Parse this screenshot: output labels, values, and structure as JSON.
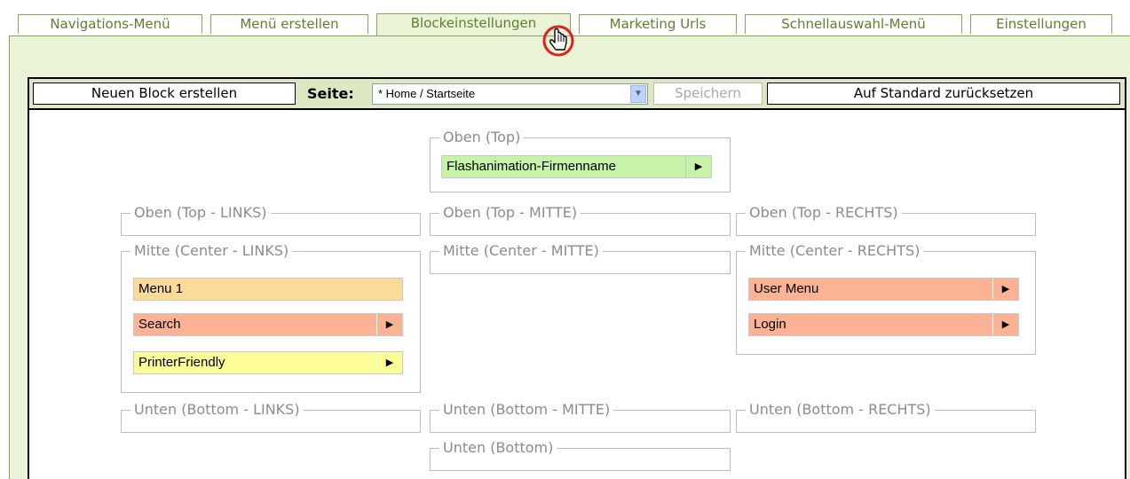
{
  "tabs": [
    {
      "label": "Navigations-Menü"
    },
    {
      "label": "Menü erstellen"
    },
    {
      "label": "Blockeinstellungen",
      "active": true
    },
    {
      "label": "Marketing Urls"
    },
    {
      "label": "Schnellauswahl-Menü"
    },
    {
      "label": "Einstellungen"
    }
  ],
  "toolbar": {
    "new_block": "Neuen Block erstellen",
    "seite_label": "Seite:",
    "seite_value": "* Home / Startseite",
    "save": "Speichern",
    "reset": "Auf Standard zurücksetzen"
  },
  "regions": {
    "top": {
      "label": "Oben (Top)",
      "blocks": [
        {
          "label": "Flashanimation-Firmenname",
          "color": "#c6f3a8",
          "has_arrow": true
        }
      ]
    },
    "top_left": {
      "label": "Oben (Top - LINKS)"
    },
    "top_center": {
      "label": "Oben (Top - MITTE)"
    },
    "top_right": {
      "label": "Oben (Top - RECHTS)"
    },
    "center_left": {
      "label": "Mitte (Center - LINKS)",
      "blocks": [
        {
          "label": "Menu 1",
          "color": "#fcdb98",
          "has_arrow": false
        },
        {
          "label": "Search",
          "color": "#fbb295",
          "has_arrow": true
        },
        {
          "label": "PrinterFriendly",
          "color": "#fdfd98",
          "has_arrow": true
        }
      ]
    },
    "center_center": {
      "label": "Mitte (Center - MITTE)"
    },
    "center_right": {
      "label": "Mitte (Center - RECHTS)",
      "blocks": [
        {
          "label": "User Menu",
          "color": "#fbb295",
          "has_arrow": true
        },
        {
          "label": "Login",
          "color": "#fbb295",
          "has_arrow": true
        }
      ]
    },
    "bottom_left": {
      "label": "Unten (Bottom - LINKS)"
    },
    "bottom_center": {
      "label": "Unten (Bottom - MITTE)"
    },
    "bottom_right": {
      "label": "Unten (Bottom - RECHTS)"
    },
    "bottom": {
      "label": "Unten (Bottom)"
    }
  },
  "icons": {
    "arrow": "triangle-right-icon",
    "select_arrow": "chevron-down-icon",
    "cursor": "hand-pointer-icon"
  },
  "colors": {
    "accent": "#8aa35f",
    "panel": "#eaf3d8",
    "toolbar": "#dce9c0"
  }
}
